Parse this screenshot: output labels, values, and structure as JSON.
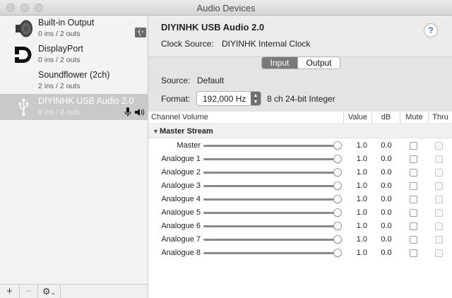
{
  "window": {
    "title": "Audio Devices"
  },
  "sidebar": {
    "devices": [
      {
        "name": "Built-in Output",
        "io": "0 ins / 2 outs",
        "icon": "speaker-icon",
        "selected": false
      },
      {
        "name": "DisplayPort",
        "io": "0 ins / 2 outs",
        "icon": "displayport-icon",
        "selected": false
      },
      {
        "name": "Soundflower (2ch)",
        "io": "2 ins / 2 outs",
        "icon": "none",
        "selected": false
      },
      {
        "name": "DIYINHK USB Audio 2.0",
        "io": "8 ins / 8 outs",
        "icon": "usb-icon",
        "selected": true
      }
    ],
    "bottom": {
      "add": "+",
      "remove": "−",
      "gear": "⚙︎",
      "gear_menu": "⌄"
    }
  },
  "detail": {
    "device_name": "DIYINHK USB Audio 2.0",
    "help": "?",
    "clock_source_label": "Clock Source:",
    "clock_source_value": "DIYINHK Internal Clock",
    "tabs": [
      {
        "label": "Input",
        "active": true
      },
      {
        "label": "Output",
        "active": false
      }
    ],
    "source_label": "Source:",
    "source_value": "Default",
    "format_label": "Format:",
    "format_value": "192,000 Hz",
    "format_detail": "8 ch 24-bit Integer"
  },
  "table": {
    "headers": {
      "channel": "Channel Volume",
      "value": "Value",
      "db": "dB",
      "mute": "Mute",
      "thru": "Thru"
    },
    "group": "Master Stream",
    "rows": [
      {
        "label": "Master",
        "value": "1.0",
        "db": "0.0",
        "level": 1.0
      },
      {
        "label": "Analogue 1",
        "value": "1.0",
        "db": "0.0",
        "level": 1.0
      },
      {
        "label": "Analogue 2",
        "value": "1.0",
        "db": "0.0",
        "level": 1.0
      },
      {
        "label": "Analogue 3",
        "value": "1.0",
        "db": "0.0",
        "level": 1.0
      },
      {
        "label": "Analogue 4",
        "value": "1.0",
        "db": "0.0",
        "level": 1.0
      },
      {
        "label": "Analogue 5",
        "value": "1.0",
        "db": "0.0",
        "level": 1.0
      },
      {
        "label": "Analogue 6",
        "value": "1.0",
        "db": "0.0",
        "level": 1.0
      },
      {
        "label": "Analogue 7",
        "value": "1.0",
        "db": "0.0",
        "level": 1.0
      },
      {
        "label": "Analogue 8",
        "value": "1.0",
        "db": "0.0",
        "level": 1.0
      }
    ]
  },
  "colors": {
    "accent": "#3b79d9",
    "selection": "#c9c9c9",
    "segment_active": "#7a7a7a"
  }
}
